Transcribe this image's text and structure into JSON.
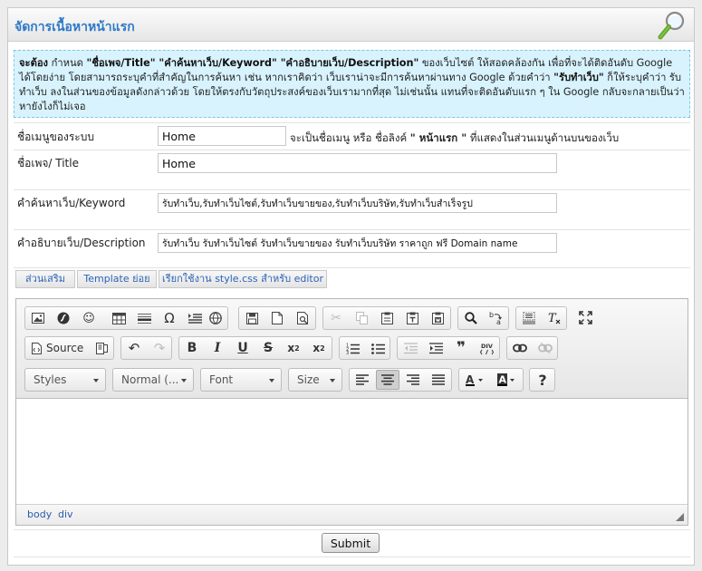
{
  "header": {
    "title": "จัดการเนื้อหาหน้าแรก",
    "icon": "magnifier-icon"
  },
  "notice": {
    "p1": "จะต้อง",
    "p2": " กำหนด ",
    "p3": "\"ชื่อเพจ/Title\" \"คำค้นหาเว็บ/Keyword\" \"คำอธิบายเว็บ/Description\"",
    "p4": " ของเว็บไซต์ ให้สอดคล้องกัน เพื่อที่จะได้ติดอันดับ Google ได้โดยง่าย โดยสามารถระบุคำที่สำคัญในการค้นหา เช่น หากเราคิดว่า เว็บเราน่าจะมีการค้นหาผ่านทาง Google ด้วยคำว่า ",
    "p5": "\"รับทำเว็บ\"",
    "p6": " ก็ให้ระบุคำว่า รับทำเว็บ ลงในส่วนของข้อมูลดังกล่าวด้วย โดยให้ตรงกับวัตถุประสงค์ของเว็บเรามากที่สุด ไม่เช่นนั้น แทนที่จะติดอันดับแรก ๆ ใน Google กลับจะกลายเป็นว่า หายังไงก็ไม่เจอ"
  },
  "form": {
    "menu_label": "ชื่อเมนูของระบบ",
    "menu_value": "Home",
    "menu_hint_a": "จะเป็นชื่อเมนู หรือ ชื่อลิงค์ ",
    "menu_hint_b": "\" หน้าแรก \"",
    "menu_hint_c": " ที่แสดงในส่วนเมนูด้านบนของเว็บ",
    "title_label": "ชื่อเพจ/ Title",
    "title_value": "Home",
    "keyword_label": "คำค้นหาเว็บ/Keyword",
    "keyword_value": "รับทำเว็บ,รับทำเว็บไซต์,รับทำเว็บขายของ,รับทำเว็บบริษัท,รับทำเว็บสำเร็จรูป",
    "description_label": "คำอธิบายเว็บ/Description",
    "description_value": "รับทำเว็บ รับทำเว็บไซต์ รับทำเว็บขายของ รับทำเว็บบริษัท ราคาถูก ฟรี Domain name"
  },
  "tabs": [
    "ส่วนเสริม",
    "Template ย่อย",
    "เรียกใช้งาน style.css สำหรับ editor"
  ],
  "editor": {
    "source_label": "Source",
    "styles_label": "Styles",
    "format_label": "Normal (...",
    "font_label": "Font",
    "size_label": "Size",
    "path_body": "body",
    "path_div": "div"
  },
  "submit_label": "Submit"
}
